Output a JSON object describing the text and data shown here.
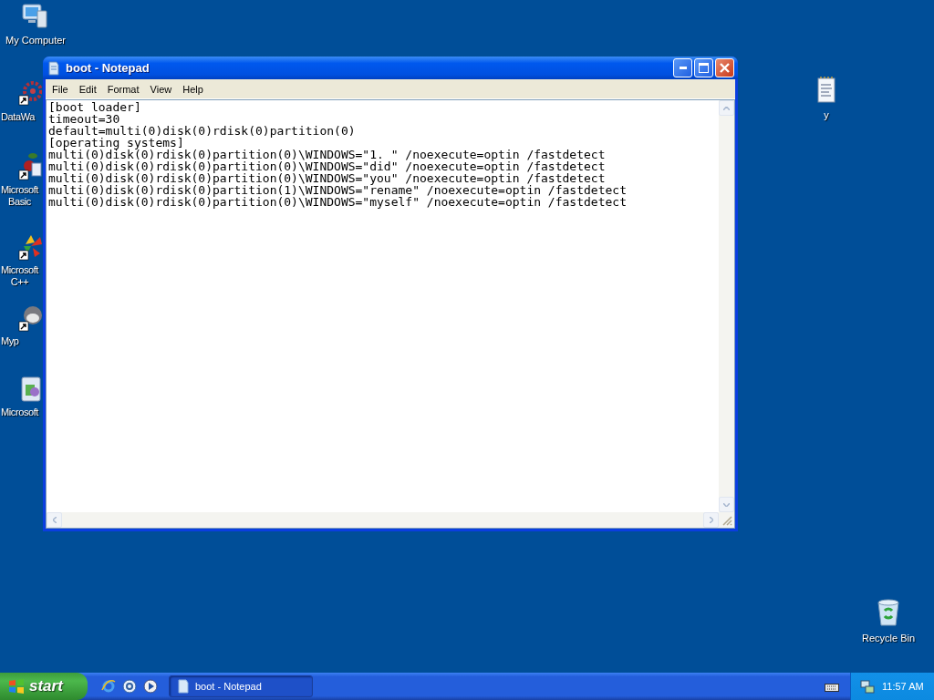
{
  "desktop_icons": [
    {
      "lines": [
        "My Computer"
      ],
      "shortcut": false
    },
    {
      "lines": [
        "DataWa"
      ],
      "shortcut": true
    },
    {
      "lines": [
        "Microsoft",
        "Basic"
      ],
      "shortcut": true
    },
    {
      "lines": [
        "Microsoft",
        "C++"
      ],
      "shortcut": true
    },
    {
      "lines": [
        "Myp"
      ],
      "shortcut": true
    },
    {
      "lines": [
        "Microsoft"
      ],
      "shortcut": false
    }
  ],
  "right_icons": [
    {
      "lines": [
        "y"
      ]
    },
    {
      "lines": [
        "Recycle Bin"
      ]
    }
  ],
  "window": {
    "title": "boot - Notepad",
    "menu": [
      "File",
      "Edit",
      "Format",
      "View",
      "Help"
    ],
    "lines": [
      "[boot loader]",
      "timeout=30",
      "default=multi(0)disk(0)rdisk(0)partition(0)",
      "[operating systems]",
      "multi(0)disk(0)rdisk(0)partition(0)\\WINDOWS=\"1. \" /noexecute=optin /fastdetect",
      "multi(0)disk(0)rdisk(0)partition(0)\\WINDOWS=\"did\" /noexecute=optin /fastdetect",
      "multi(0)disk(0)rdisk(0)partition(0)\\WINDOWS=\"you\" /noexecute=optin /fastdetect",
      "multi(0)disk(0)rdisk(0)partition(1)\\WINDOWS=\"rename\" /noexecute=optin /fastdetect",
      "multi(0)disk(0)rdisk(0)partition(0)\\WINDOWS=\"myself\" /noexecute=optin /fastdetect"
    ]
  },
  "taskbar": {
    "start": "start",
    "tasks": [
      {
        "label": "boot - Notepad",
        "selected": true
      }
    ],
    "clock": "11:57 AM"
  }
}
